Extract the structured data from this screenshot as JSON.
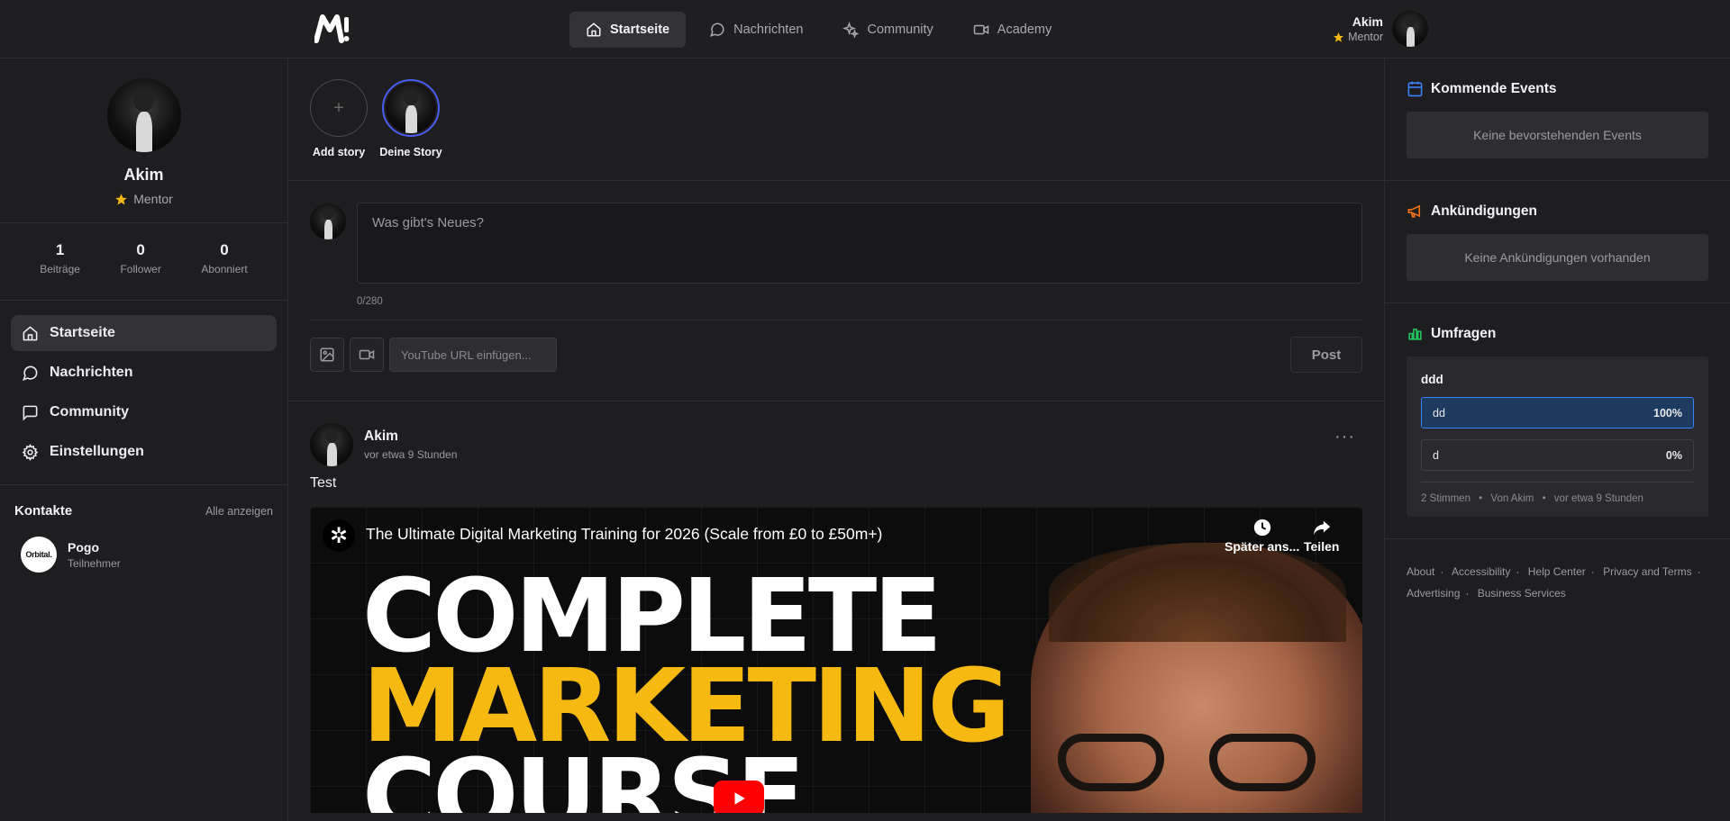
{
  "topbar": {
    "nav": [
      {
        "label": "Startseite",
        "icon": "home-icon",
        "active": true
      },
      {
        "label": "Nachrichten",
        "icon": "chat-icon",
        "active": false
      },
      {
        "label": "Community",
        "icon": "sparkles-icon",
        "active": false
      },
      {
        "label": "Academy",
        "icon": "video-icon",
        "active": false
      }
    ],
    "user_name": "Akim",
    "user_role": "Mentor"
  },
  "profile": {
    "name": "Akim",
    "role": "Mentor",
    "stats": [
      {
        "value": "1",
        "label": "Beiträge"
      },
      {
        "value": "0",
        "label": "Follower"
      },
      {
        "value": "0",
        "label": "Abonniert"
      }
    ]
  },
  "sidebar": {
    "items": [
      {
        "label": "Startseite",
        "icon": "home-icon",
        "active": true
      },
      {
        "label": "Nachrichten",
        "icon": "chat-icon",
        "active": false
      },
      {
        "label": "Community",
        "icon": "message-square-icon",
        "active": false
      },
      {
        "label": "Einstellungen",
        "icon": "gear-icon",
        "active": false
      }
    ]
  },
  "contacts": {
    "title": "Kontakte",
    "show_all": "Alle anzeigen",
    "items": [
      {
        "name": "Pogo",
        "role": "Teilnehmer",
        "logo_text": "Orbital."
      }
    ]
  },
  "stories": {
    "add_label": "Add story",
    "own_label": "Deine Story"
  },
  "composer": {
    "placeholder": "Was gibt's Neues?",
    "counter": "0/280",
    "youtube_placeholder": "YouTube URL einfügen...",
    "post_label": "Post"
  },
  "post": {
    "author": "Akim",
    "time": "vor etwa 9 Stunden",
    "text": "Test",
    "more": "···",
    "video": {
      "title": "The Ultimate Digital Marketing Training for 2026 (Scale from £0 to £50m+)",
      "watch_later": "Später ans...",
      "share": "Teilen",
      "line1": "COMPLETE",
      "line2": "MARKETING",
      "line3": "COURSE"
    }
  },
  "right": {
    "events": {
      "title": "Kommende Events",
      "empty": "Keine bevorstehenden Events"
    },
    "announcements": {
      "title": "Ankündigungen",
      "empty": "Keine Ankündigungen vorhanden"
    },
    "polls": {
      "title": "Umfragen",
      "question": "ddd",
      "options": [
        {
          "label": "dd",
          "percent": "100%",
          "fill": 1.0,
          "selected": true
        },
        {
          "label": "d",
          "percent": "0%",
          "fill": 0.0,
          "selected": false
        }
      ],
      "votes": "2 Stimmen",
      "by": "Von Akim",
      "time": "vor etwa 9 Stunden"
    },
    "footer_links": [
      "About",
      "Accessibility",
      "Help Center",
      "Privacy and Terms",
      "Advertising",
      "Business Services"
    ]
  },
  "colors": {
    "accent_blue": "#3b82f6",
    "story_ring": "#4a5ff0",
    "star": "#f5b912",
    "announcement": "#f97316",
    "polls": "#22c55e",
    "events": "#3b82f6"
  }
}
